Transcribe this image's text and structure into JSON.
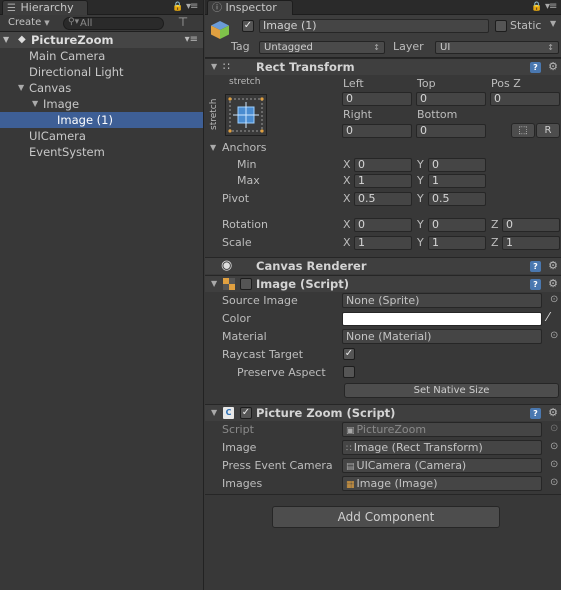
{
  "hierarchy": {
    "tab_label": "Hierarchy",
    "create_label": "Create",
    "search_placeholder": "All",
    "scene_name": "PictureZoom",
    "items": [
      {
        "label": "Main Camera",
        "depth": 1,
        "foldable": false,
        "selected": false
      },
      {
        "label": "Directional Light",
        "depth": 1,
        "foldable": false,
        "selected": false
      },
      {
        "label": "Canvas",
        "depth": 1,
        "foldable": true,
        "selected": false
      },
      {
        "label": "Image",
        "depth": 2,
        "foldable": true,
        "selected": false
      },
      {
        "label": "Image (1)",
        "depth": 3,
        "foldable": false,
        "selected": true
      },
      {
        "label": "UICamera",
        "depth": 1,
        "foldable": false,
        "selected": false
      },
      {
        "label": "EventSystem",
        "depth": 1,
        "foldable": false,
        "selected": false
      }
    ]
  },
  "inspector": {
    "tab_label": "Inspector",
    "object_name": "Image (1)",
    "active": true,
    "static_label": "Static",
    "static_checked": false,
    "tag_label": "Tag",
    "tag_value": "Untagged",
    "layer_label": "Layer",
    "layer_value": "UI",
    "rect_transform": {
      "title": "Rect Transform",
      "anchor_top_label": "stretch",
      "anchor_side_label": "stretch",
      "left_label": "Left",
      "left_value": "0",
      "top_label": "Top",
      "top_value": "0",
      "posz_label": "Pos Z",
      "posz_value": "0",
      "right_label": "Right",
      "right_value": "0",
      "bottom_label": "Bottom",
      "bottom_value": "0",
      "raw_button": "R",
      "anchors_label": "Anchors",
      "min_label": "Min",
      "min_x": "0",
      "min_y": "0",
      "max_label": "Max",
      "max_x": "1",
      "max_y": "1",
      "pivot_label": "Pivot",
      "pivot_x": "0.5",
      "pivot_y": "0.5",
      "rotation_label": "Rotation",
      "rot_x": "0",
      "rot_y": "0",
      "rot_z": "0",
      "scale_label": "Scale",
      "scale_x": "1",
      "scale_y": "1",
      "scale_z": "1",
      "x": "X",
      "y": "Y",
      "z": "Z"
    },
    "canvas_renderer": {
      "title": "Canvas Renderer"
    },
    "image_script": {
      "title": "Image (Script)",
      "enabled": false,
      "source_image_label": "Source Image",
      "source_image_value": "None (Sprite)",
      "color_label": "Color",
      "color_value": "#ffffff",
      "material_label": "Material",
      "material_value": "None (Material)",
      "raycast_label": "Raycast Target",
      "raycast_checked": true,
      "preserve_label": "Preserve Aspect",
      "preserve_checked": false,
      "native_size_button": "Set Native Size"
    },
    "picture_zoom": {
      "title": "Picture Zoom (Script)",
      "enabled": true,
      "script_label": "Script",
      "script_value": "PictureZoom",
      "image_label": "Image",
      "image_value": "Image (Rect Transform)",
      "press_label": "Press Event Camera",
      "press_value": "UICamera (Camera)",
      "images_label": "Images",
      "images_value": "Image (Image)"
    },
    "add_component": "Add Component"
  }
}
